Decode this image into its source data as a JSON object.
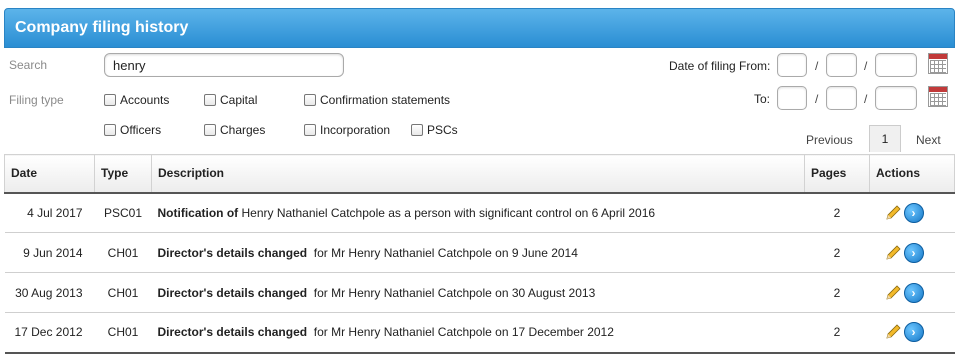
{
  "title": "Company filing history",
  "filters": {
    "search_label": "Search",
    "search_value": "henry",
    "filing_type_label": "Filing type",
    "date_from_label": "Date of filing From:",
    "date_to_label": "To:",
    "date_separator": "/",
    "types": [
      {
        "label": "Accounts",
        "checked": false
      },
      {
        "label": "Capital",
        "checked": false
      },
      {
        "label": "Confirmation statements",
        "checked": false
      },
      {
        "label": "Officers",
        "checked": false
      },
      {
        "label": "Charges",
        "checked": false
      },
      {
        "label": "Incorporation",
        "checked": false
      },
      {
        "label": "PSCs",
        "checked": false
      }
    ]
  },
  "pagination": {
    "previous": "Previous",
    "current": "1",
    "next": "Next"
  },
  "table": {
    "columns": [
      "Date",
      "Type",
      "Description",
      "Pages",
      "Actions"
    ],
    "rows": [
      {
        "date": "4 Jul 2017",
        "type": "PSC01",
        "desc_bold": "Notification of",
        "desc_rest": " Henry Nathaniel Catchpole as a person with significant control on 6 April 2016",
        "pages": "2"
      },
      {
        "date": "9 Jun 2014",
        "type": "CH01",
        "desc_bold": "Director's details changed",
        "desc_rest": "  for Mr Henry Nathaniel Catchpole on 9 June 2014",
        "pages": "2"
      },
      {
        "date": "30 Aug 2013",
        "type": "CH01",
        "desc_bold": "Director's details changed",
        "desc_rest": "  for Mr Henry Nathaniel Catchpole on 30 August 2013",
        "pages": "2"
      },
      {
        "date": "17 Dec 2012",
        "type": "CH01",
        "desc_bold": "Director's details changed",
        "desc_rest": "  for Mr Henry Nathaniel Catchpole on 17 December 2012",
        "pages": "2"
      }
    ]
  },
  "icons": {
    "edit": "pencil-icon",
    "view": "arrow-right-circle-icon",
    "calendar": "calendar-icon"
  },
  "colors": {
    "header_blue": "#2a8ed3",
    "calendar_red": "#c23a3a"
  }
}
